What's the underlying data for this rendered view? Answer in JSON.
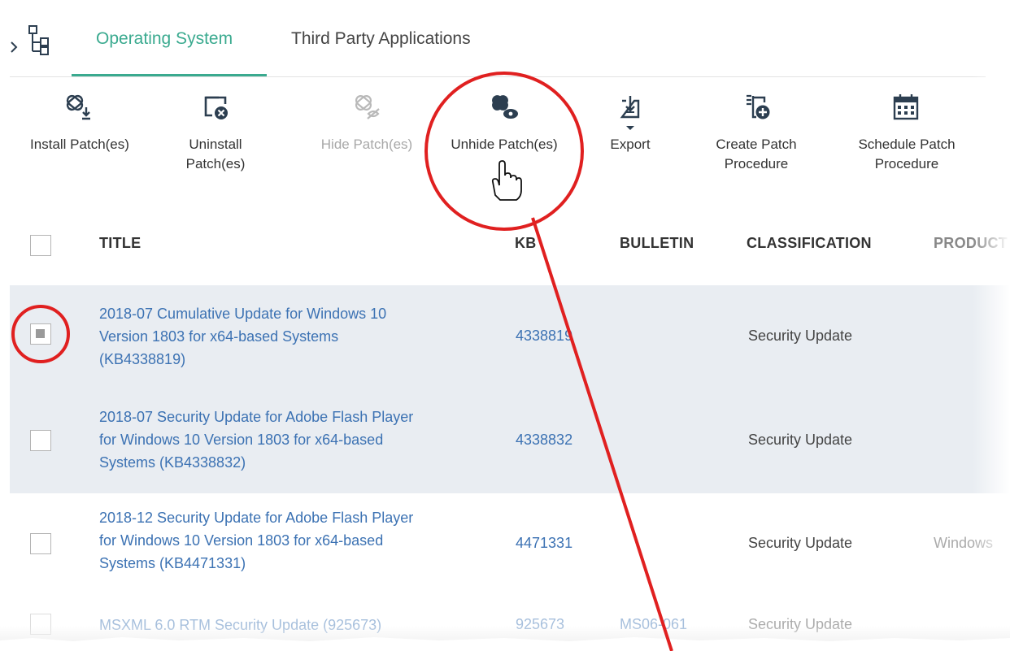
{
  "tabs": {
    "items": [
      {
        "label": "Operating System",
        "active": true
      },
      {
        "label": "Third Party Applications",
        "active": false
      }
    ]
  },
  "toolbar": {
    "install": {
      "label": "Install Patch(es)",
      "icon": "install-patch-icon"
    },
    "uninstall": {
      "label_line1": "Uninstall",
      "label_line2": "Patch(es)",
      "icon": "uninstall-patch-icon"
    },
    "hide": {
      "label": "Hide Patch(es)",
      "icon": "hide-patch-icon",
      "disabled": true
    },
    "unhide": {
      "label": "Unhide Patch(es)",
      "icon": "unhide-patch-icon"
    },
    "export": {
      "label": "Export",
      "icon": "export-icon"
    },
    "create": {
      "label_line1": "Create Patch",
      "label_line2": "Procedure",
      "icon": "create-procedure-icon"
    },
    "schedule": {
      "label_line1": "Schedule Patch",
      "label_line2": "Procedure",
      "icon": "schedule-calendar-icon"
    }
  },
  "table": {
    "headers": {
      "title": "TITLE",
      "kb": "KB",
      "bulletin": "BULLETIN",
      "classification": "CLASSIFICATION",
      "product": "PRODUCT"
    },
    "rows": [
      {
        "checked": true,
        "title_lines": [
          "2018-07 Cumulative Update for Windows 10",
          "Version 1803 for x64-based Systems",
          "(KB4338819)"
        ],
        "kb": "4338819",
        "bulletin": "",
        "classification": "Security Update",
        "product": ""
      },
      {
        "checked": false,
        "title_lines": [
          "2018-07 Security Update for Adobe Flash Player",
          "for Windows 10 Version 1803 for x64-based",
          "Systems (KB4338832)"
        ],
        "kb": "4338832",
        "bulletin": "",
        "classification": "Security Update",
        "product": ""
      },
      {
        "checked": false,
        "title_lines": [
          "2018-12 Security Update for Adobe Flash Player",
          "for Windows 10 Version 1803 for x64-based",
          "Systems (KB4471331)"
        ],
        "kb": "4471331",
        "bulletin": "",
        "classification": "Security Update",
        "product": "Windows"
      },
      {
        "checked": false,
        "title_lines": [
          "MSXML 6.0 RTM Security Update (925673)"
        ],
        "kb": "925673",
        "bulletin": "MS06-061",
        "classification": "Security Update",
        "product": ""
      }
    ]
  },
  "colors": {
    "accent": "#3aaa8f",
    "link": "#3c72b3",
    "annotation": "#e02020",
    "row_selected": "#e9edf2"
  }
}
